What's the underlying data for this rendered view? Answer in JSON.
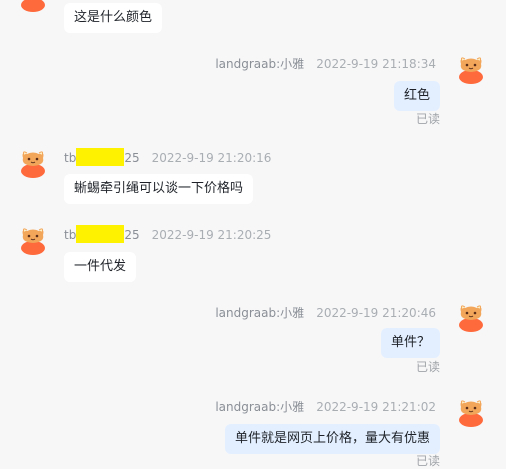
{
  "messages": [
    {
      "text": "这是什么颜色"
    },
    {
      "name": "landgraab:小雅",
      "time": "2022-9-19 21:18:34",
      "text": "红色",
      "status": "已读"
    },
    {
      "name_prefix": "tb",
      "name_suffix": "25",
      "time": "2022-9-19 21:20:16",
      "text": "蜥蜴牵引绳可以谈一下价格吗"
    },
    {
      "name_prefix": "tb",
      "name_suffix": "25",
      "time": "2022-9-19 21:20:25",
      "text": "一件代发"
    },
    {
      "name": "landgraab:小雅",
      "time": "2022-9-19 21:20:46",
      "text": "单件？",
      "status": "已读"
    },
    {
      "name": "landgraab:小雅",
      "time": "2022-9-19 21:21:02",
      "text": "单件就是网页上价格，量大有优惠",
      "status": "已读"
    }
  ],
  "colors": {
    "background": "#f7f7f8",
    "outgoing_bubble": "#e3efff",
    "incoming_bubble": "#ffffff",
    "redaction": "#fff200",
    "avatar": "#ff7a3d"
  }
}
